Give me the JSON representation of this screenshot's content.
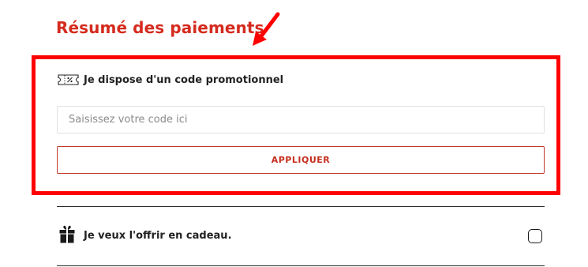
{
  "payment_summary": {
    "title": "Résumé des paiements"
  },
  "promo": {
    "toggle_label": "Je dispose d'un code promotionnel",
    "icon": "coupon-icon",
    "input_placeholder": "Saisissez votre code ici",
    "input_value": "",
    "apply_label": "APPLIQUER"
  },
  "gift": {
    "label": "Je veux l'offrir en cadeau.",
    "icon": "gift-icon",
    "checked": false
  },
  "colors": {
    "brand": "#d52b1e",
    "annotation": "#ff0000",
    "text": "#222222"
  }
}
